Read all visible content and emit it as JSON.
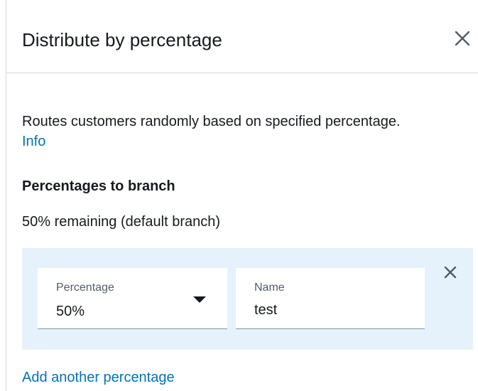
{
  "header": {
    "title": "Distribute by percentage",
    "close_icon": "close-icon"
  },
  "description": {
    "text": "Routes customers randomly based on specified percentage.",
    "info_link": "Info"
  },
  "section": {
    "heading": "Percentages to branch",
    "remaining": "50% remaining (default branch)"
  },
  "branches": [
    {
      "percentage_label": "Percentage",
      "percentage_value": "50%",
      "name_label": "Name",
      "name_value": "test",
      "remove_icon": "close-icon"
    }
  ],
  "actions": {
    "add_link": "Add another percentage"
  },
  "colors": {
    "link": "#0073bb",
    "branch_background": "#e6f2fb",
    "text": "#16191f",
    "divider": "#d5dbdb"
  }
}
